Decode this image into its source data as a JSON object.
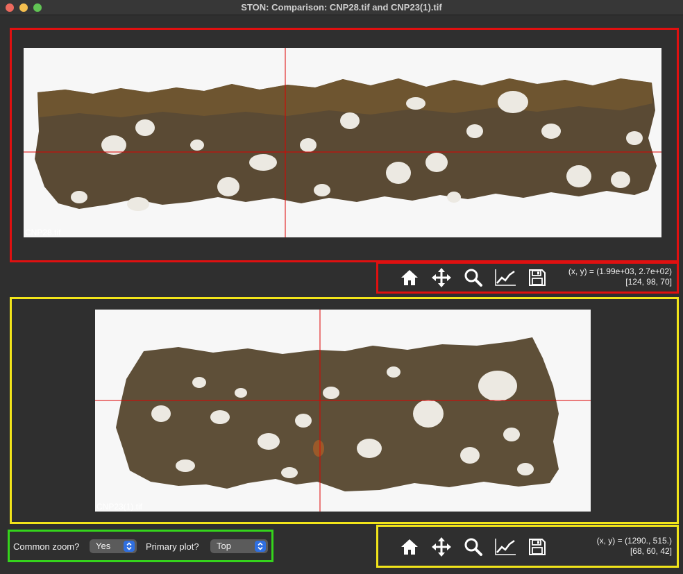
{
  "window": {
    "title": "STON: Comparison: CNP28.tif and CNP23(1).tif"
  },
  "top_plot": {
    "image_label": "CNP28.tif",
    "coords_line1": "(x, y) = (1.99e+03, 2.7e+02)",
    "coords_line2": "[124, 98, 70]"
  },
  "bottom_plot": {
    "image_label": "CNP23(1).tif",
    "coords_line1": "(x, y) = (1290., 515.)",
    "coords_line2": "[68, 60, 42]"
  },
  "toolbar": {
    "icons": [
      "home-icon",
      "pan-icon",
      "zoom-icon",
      "subplots-icon",
      "save-icon"
    ]
  },
  "controls": {
    "common_zoom_label": "Common zoom?",
    "common_zoom_value": "Yes",
    "primary_plot_label": "Primary plot?",
    "primary_plot_value": "Top"
  },
  "colors": {
    "top_highlight": "#e01010",
    "bottom_highlight": "#f2e51a",
    "controls_highlight": "#35d41c",
    "crosshair": "#dd0000",
    "sample": "#5a4a34"
  }
}
